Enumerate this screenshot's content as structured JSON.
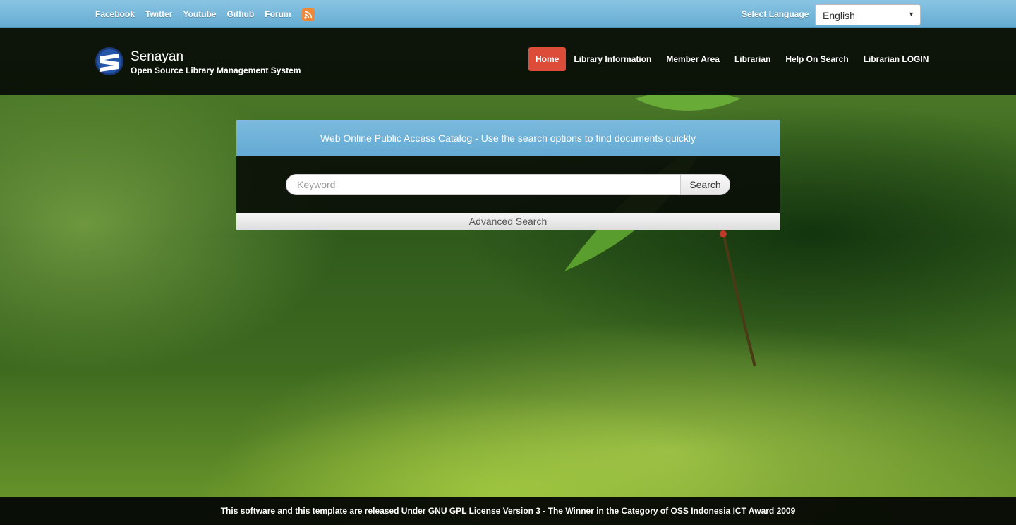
{
  "topbar": {
    "social_links": [
      {
        "label": "Facebook"
      },
      {
        "label": "Twitter"
      },
      {
        "label": "Youtube"
      },
      {
        "label": "Github"
      },
      {
        "label": "Forum"
      }
    ],
    "rss_icon": "rss-icon",
    "language_label": "Select Language",
    "language_value": "English"
  },
  "header": {
    "title": "Senayan",
    "subtitle": "Open Source Library Management System",
    "nav": [
      {
        "label": "Home",
        "active": true
      },
      {
        "label": "Library Information"
      },
      {
        "label": "Member Area"
      },
      {
        "label": "Librarian"
      },
      {
        "label": "Help On Search"
      },
      {
        "label": "Librarian LOGIN"
      }
    ]
  },
  "search": {
    "heading": "Web Online Public Access Catalog - Use the search options to find documents quickly",
    "placeholder": "Keyword",
    "value": "",
    "button_label": "Search",
    "advanced_label": "Advanced Search"
  },
  "footer": {
    "text": "This software and this template are released Under GNU GPL License Version 3 - The Winner in the Category of OSS Indonesia ICT Award 2009"
  },
  "colors": {
    "topbar": "#75b8dc",
    "active_nav": "#dd4b39",
    "rss": "#f0883a"
  }
}
